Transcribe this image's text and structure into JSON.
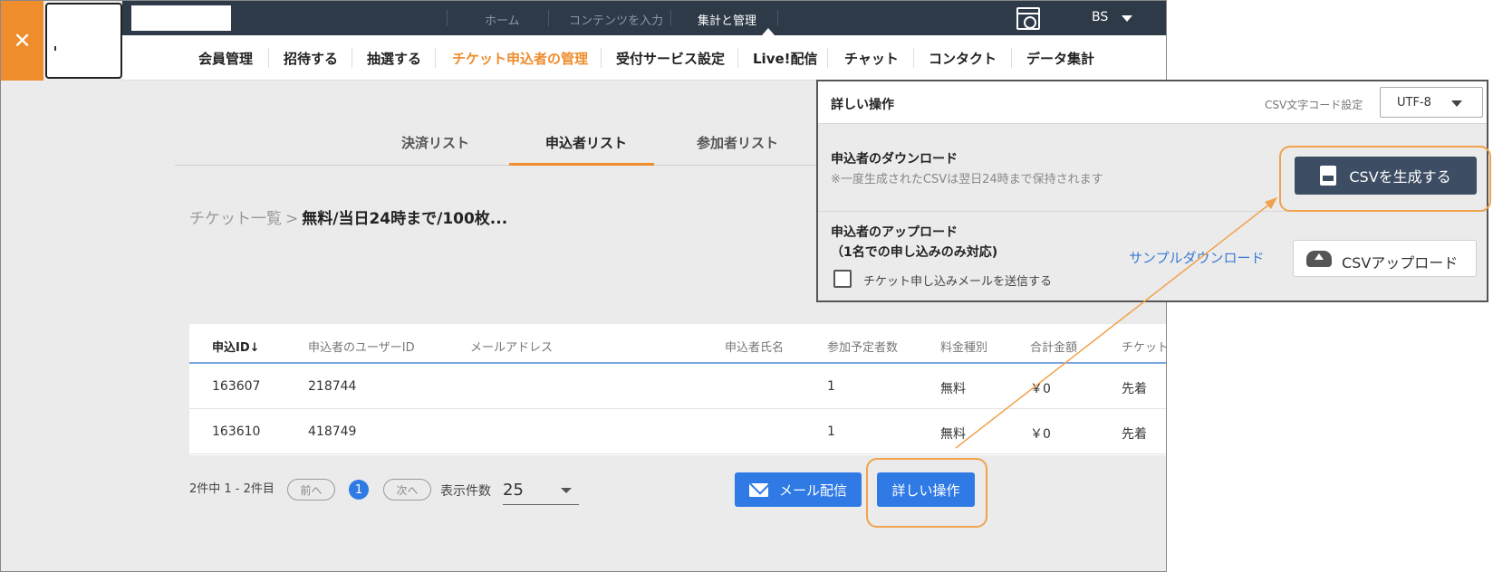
{
  "header": {
    "close_icon": "close-icon",
    "top_links": [
      "ホーム",
      "コンテンツを入力",
      "集計と管理"
    ],
    "user_label": "BS"
  },
  "nav": {
    "items": [
      "会員管理",
      "招待する",
      "抽選する",
      "チケット申込者の管理",
      "受付サービス設定",
      "Live!配信",
      "チャット",
      "コンタクト",
      "データ集計"
    ],
    "active_index": 3
  },
  "subtabs": [
    "決済リスト",
    "申込者リスト",
    "参加者リスト"
  ],
  "breadcrumb": {
    "link": "チケット一覧",
    "separator": ">",
    "current": "無料/当日24時まで/100枚..."
  },
  "table": {
    "headers": [
      "申込ID",
      "申込者のユーザーID",
      "メールアドレス",
      "申込者氏名",
      "参加予定者数",
      "料金種別",
      "合計金額",
      "チケット"
    ],
    "sort_icon": "↓",
    "rows": [
      [
        "163607",
        "218744",
        "",
        "",
        "1",
        "無料",
        "￥0",
        "先着"
      ],
      [
        "163610",
        "418749",
        "",
        "",
        "1",
        "無料",
        "￥0",
        "先着"
      ]
    ]
  },
  "pagination": {
    "summary": "2件中 1 - 2件目",
    "prev": "前へ",
    "page": "1",
    "next": "次へ",
    "per_page_label": "表示件数",
    "per_page_value": "25"
  },
  "actions": {
    "mail_label": "メール配信",
    "detail_label": "詳しい操作"
  },
  "panel": {
    "title": "詳しい操作",
    "encoding_label": "CSV文字コード設定",
    "encoding_value": "UTF-8",
    "download": {
      "title": "申込者のダウンロード",
      "note": "※一度生成されたCSVは翌日24時まで保持されます",
      "button": "CSVを生成する"
    },
    "upload": {
      "title_line1": "申込者のアップロード",
      "title_line2": "（1名での申し込みのみ対応)",
      "checkbox_label": "チケット申し込みメールを送信する",
      "checked": false,
      "sample_link": "サンプルダウンロード",
      "button": "CSVアップロード"
    }
  },
  "colors": {
    "accent_orange": "#ef8c2c",
    "primary_blue": "#2f7ae5",
    "header_dark": "#2e3a48",
    "generate_button": "#3d4d63"
  }
}
